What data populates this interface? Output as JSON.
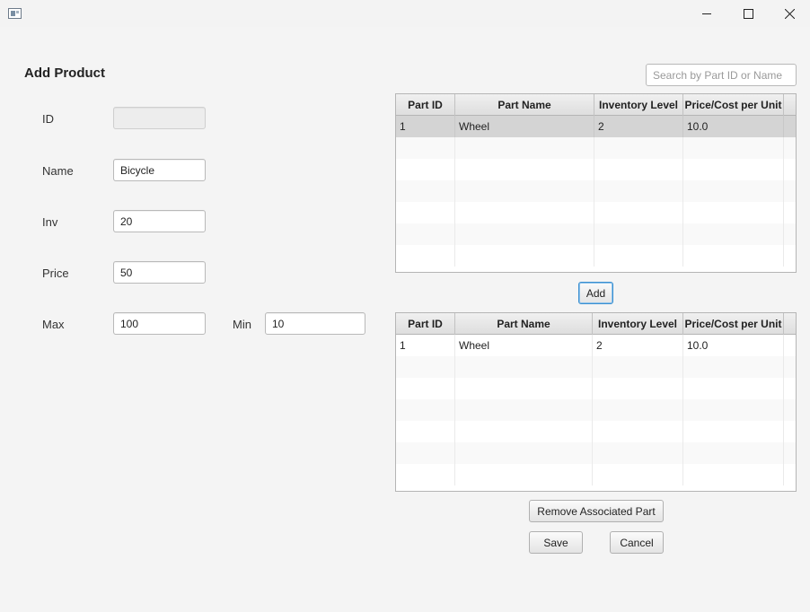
{
  "window": {
    "title": "",
    "app_icon": "window-app-icon",
    "controls": [
      "minimize-icon",
      "maximize-icon",
      "close-icon"
    ]
  },
  "page": {
    "title": "Add Product"
  },
  "form": {
    "id_label": "ID",
    "id_value": "",
    "name_label": "Name",
    "name_value": "Bicycle",
    "inv_label": "Inv",
    "inv_value": "20",
    "price_label": "Price",
    "price_value": "50",
    "max_label": "Max",
    "max_value": "100",
    "min_label": "Min",
    "min_value": "10"
  },
  "search": {
    "placeholder": "Search by Part ID or Name",
    "value": ""
  },
  "parts_table": {
    "columns": [
      "Part ID",
      "Part Name",
      "Inventory Level",
      "Price/Cost per Unit"
    ],
    "rows": [
      [
        "1",
        "Wheel",
        "2",
        "10.0"
      ]
    ],
    "selected_row": 0
  },
  "associated_table": {
    "columns": [
      "Part ID",
      "Part Name",
      "Inventory Level",
      "Price/Cost per Unit"
    ],
    "rows": [
      [
        "1",
        "Wheel",
        "2",
        "10.0"
      ]
    ]
  },
  "buttons": {
    "add": "Add",
    "remove_associated": "Remove Associated Part",
    "save": "Save",
    "cancel": "Cancel"
  }
}
